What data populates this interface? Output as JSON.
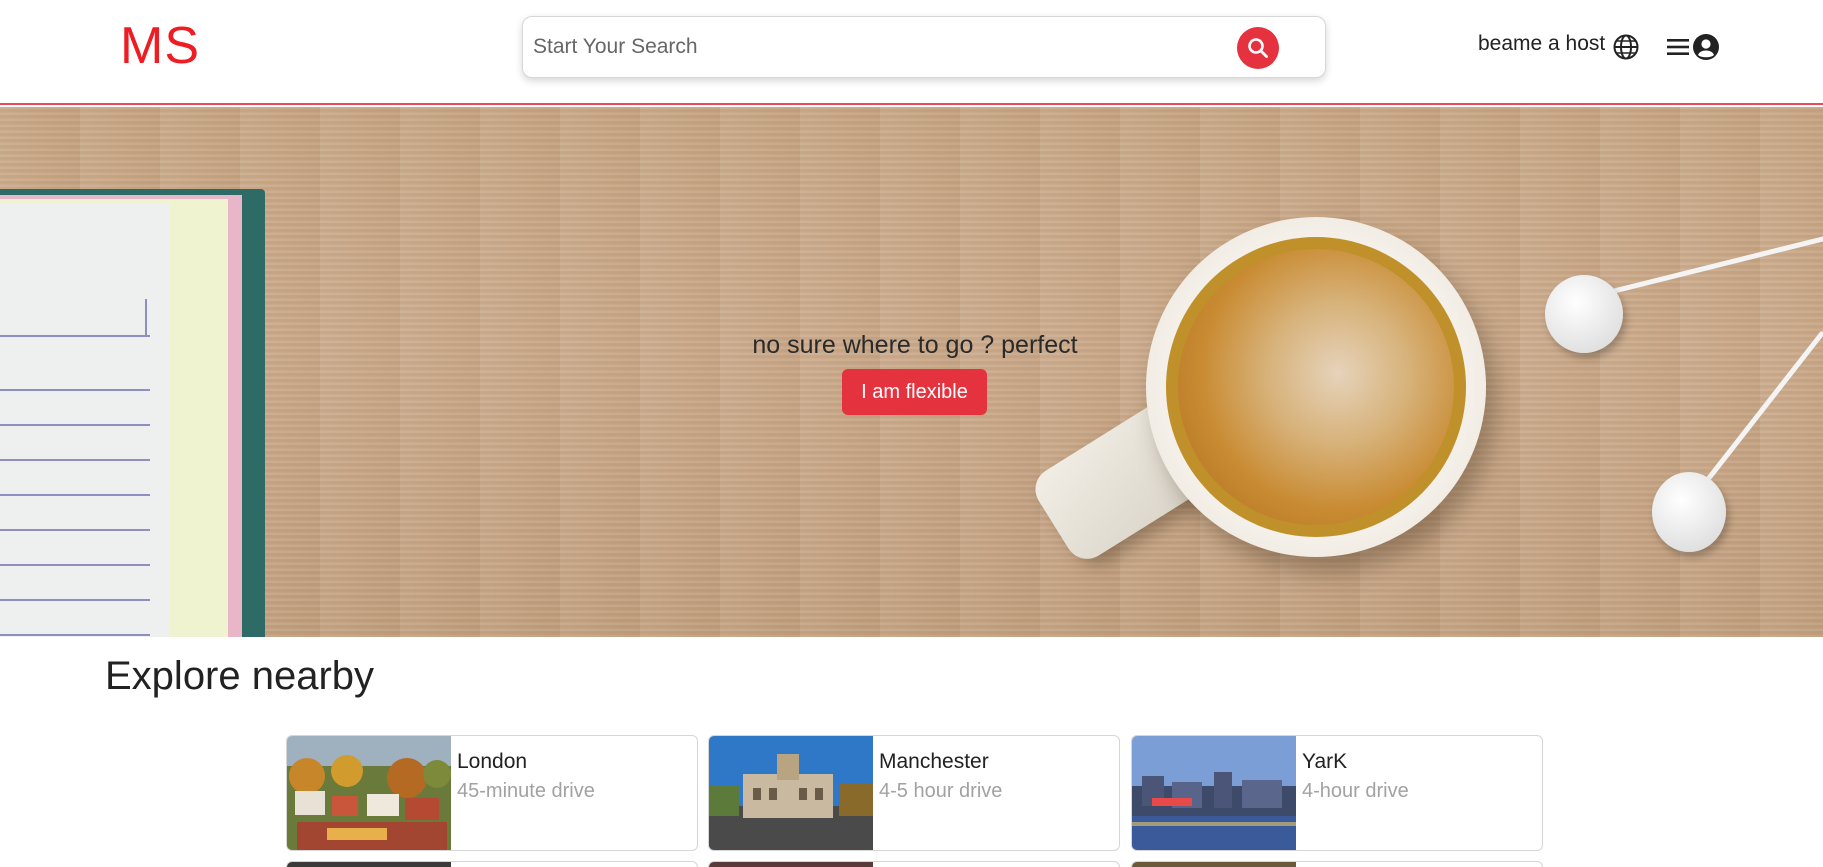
{
  "header": {
    "logo": "MS",
    "search_placeholder": "Start Your Search",
    "host_label": "beame a host",
    "icons": {
      "search": "search-icon",
      "globe": "globe-icon",
      "menu": "menu-icon",
      "account": "account-icon"
    }
  },
  "hero": {
    "tagline": "no sure where to go ? perfect",
    "button_label": "I am flexible"
  },
  "explore": {
    "title": "Explore nearby",
    "cards": [
      {
        "city": "London",
        "drive": "45-minute drive"
      },
      {
        "city": "Manchester",
        "drive": "4-5 hour drive"
      },
      {
        "city": "YarK",
        "drive": "4-hour drive"
      }
    ]
  },
  "colors": {
    "brand": "#ee1d23",
    "accent": "#e5323f",
    "muted_text": "#a2a2a2"
  }
}
